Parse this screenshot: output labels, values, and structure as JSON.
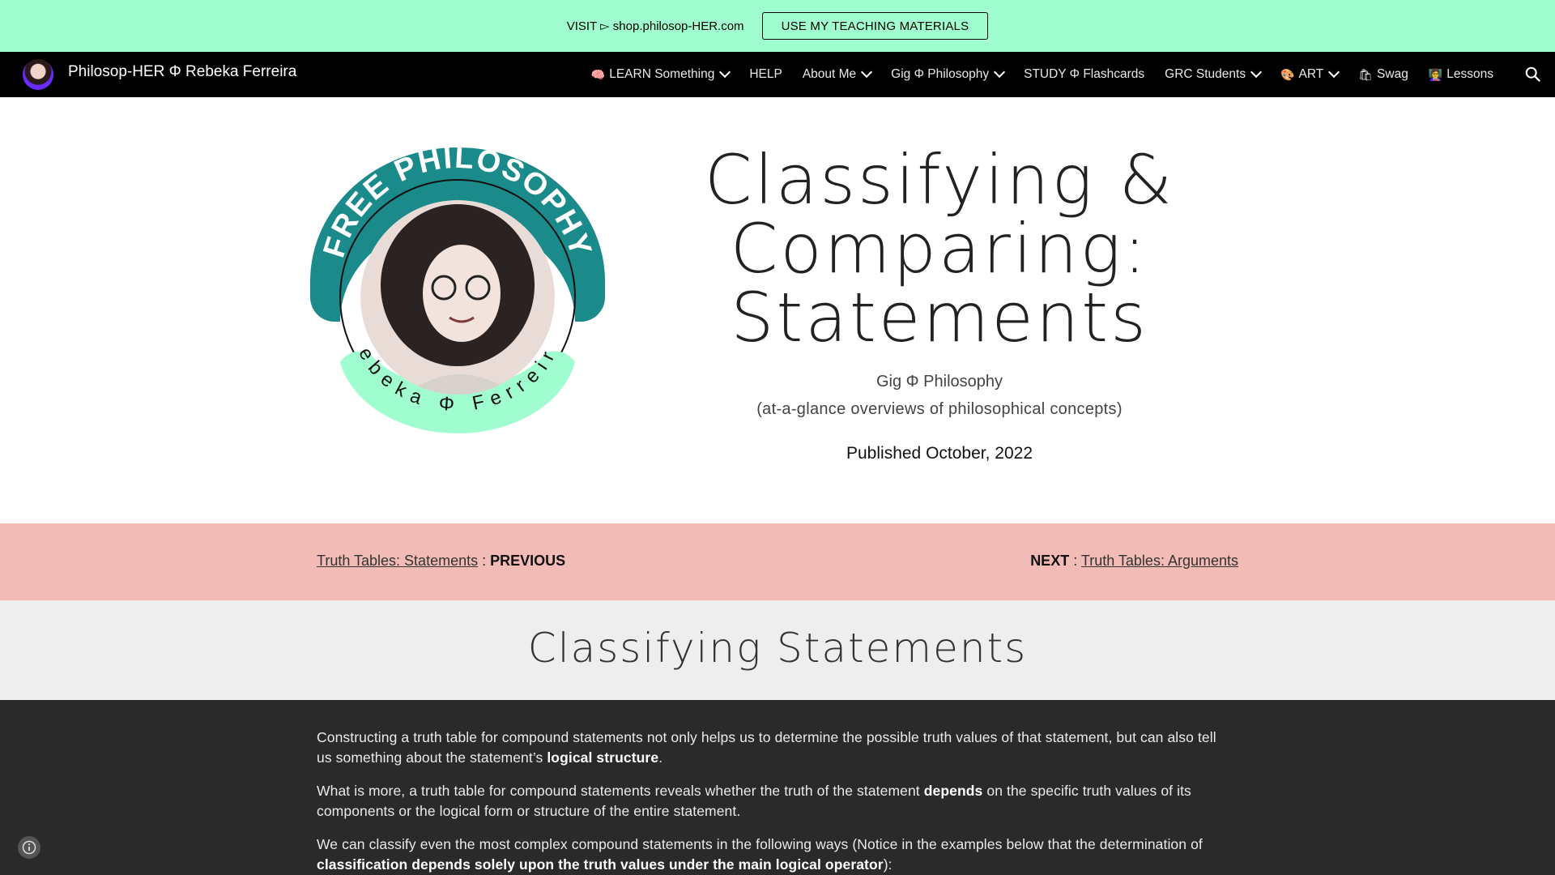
{
  "banner": {
    "text": "VISIT ▻ shop.philosop-HER.com",
    "button_label": "USE MY TEACHING MATERIALS"
  },
  "navbar": {
    "site_title": "Philosop-HER Φ Rebeka Ferreira",
    "items": [
      {
        "icon": "brain-emoji",
        "emoji": "🧠",
        "label": "LEARN Something",
        "dropdown": true
      },
      {
        "label": "HELP",
        "dropdown": false
      },
      {
        "label": "About Me",
        "dropdown": true
      },
      {
        "label": "Gig Φ Philosophy",
        "dropdown": true
      },
      {
        "label": "STUDY Φ Flashcards",
        "dropdown": false
      },
      {
        "label": "GRC Students",
        "dropdown": true
      },
      {
        "icon": "palette-emoji",
        "emoji": "🎨",
        "label": "ART",
        "dropdown": true
      },
      {
        "icon": "shopping-bag-emoji",
        "emoji": "🛍",
        "label": "Swag",
        "dropdown": false
      },
      {
        "icon": "teacher-emoji",
        "emoji": "👩‍🏫",
        "label": "Lessons",
        "dropdown": false
      }
    ],
    "search_icon": "search-icon"
  },
  "hero": {
    "logo_top_text": "FREE PHILOSOPHY",
    "logo_bottom_text": "Rebeka Φ Ferreira",
    "title": "Classifying & Comparing: Statements",
    "subtitle1": "Gig Φ Philosophy",
    "subtitle2": "(at-a-glance overviews of philosophical concepts)",
    "published": "Published October, 2022"
  },
  "pager": {
    "prev_link": "Truth Tables: Statements",
    "sep": " : ",
    "prev_label": "PREVIOUS",
    "next_label": "NEXT",
    "next_link": "Truth Tables: Arguments"
  },
  "section": {
    "title": "Classifying Statements"
  },
  "content": {
    "p1_a": "Constructing a truth table for compound statements not only helps us to determine the possible truth values of that statement, but can also tell us something about the statement’s ",
    "p1_b": "logical structure",
    "p1_c": ".",
    "p2_a": "What is more, a truth table for compound statements reveals whether the truth of the statement ",
    "p2_b": "depends",
    "p2_c": " on the specific truth values of its components or the logical form or structure of the entire statement.",
    "p3_a": "We can classify even the most complex compound statements in the following ways (Notice in the examples below that the determination of ",
    "p3_b": "classification depends solely upon the truth values under the main logical operator",
    "p3_c": "):"
  },
  "colors": {
    "banner_bg": "#a0fdd0",
    "nav_bg": "#000000",
    "pager_bg": "#f2bbb5",
    "section_bg": "#eeeeee",
    "content_bg": "#2a2a2a",
    "logo_teal": "#1a8a8a",
    "logo_mint": "#a0fdd0"
  }
}
